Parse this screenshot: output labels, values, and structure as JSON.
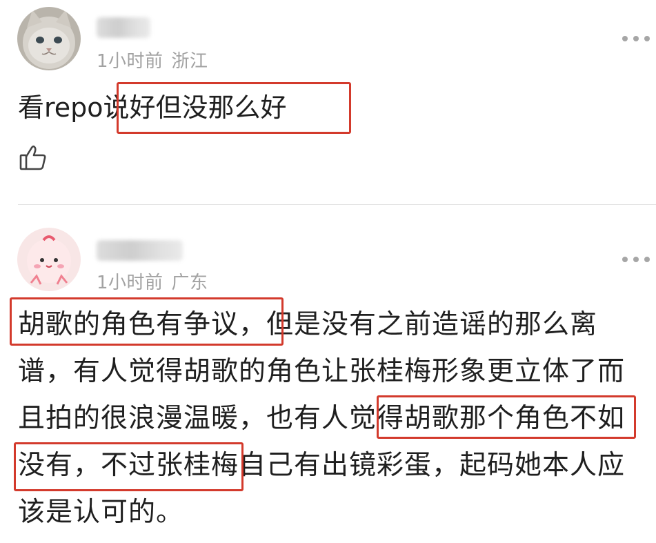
{
  "comments": [
    {
      "time": "1小时前",
      "location": "浙江",
      "text": "看repo说好但没那么好",
      "more_icon": "more-dots-icon",
      "like_icon": "thumbs-up-icon"
    },
    {
      "time": "1小时前",
      "location": "广东",
      "text": "胡歌的角色有争议，但是没有之前造谣的那么离谱，有人觉得胡歌的角色让张桂梅形象更立体了而且拍的很浪漫温暖，也有人觉得胡歌那个角色不如没有，不过张桂梅自己有出镜彩蛋，起码她本人应该是认可的。",
      "more_icon": "more-dots-icon"
    }
  ],
  "colors": {
    "highlight_box": "#d33a2c",
    "meta_text": "#a2a2a2",
    "body_text": "#1f1f1f",
    "divider": "#e2e2e2"
  }
}
